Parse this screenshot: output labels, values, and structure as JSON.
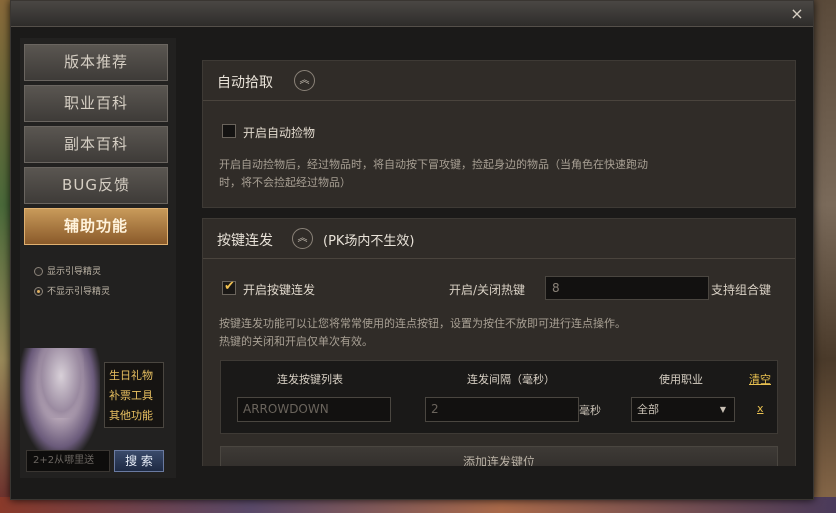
{
  "window": {
    "close_label": "×"
  },
  "sidebar": {
    "items": [
      {
        "label": "版本推荐"
      },
      {
        "label": "职业百科"
      },
      {
        "label": "副本百科"
      },
      {
        "label": "BUG反馈"
      },
      {
        "label": "辅助功能"
      }
    ],
    "radios": [
      {
        "label": "显示引导精灵",
        "checked": false
      },
      {
        "label": "不显示引导精灵",
        "checked": true
      }
    ],
    "links": [
      "生日礼物",
      "补票工具",
      "其他功能"
    ],
    "search": {
      "placeholder": "2+2从哪里送",
      "button": "搜 索"
    }
  },
  "auto_pickup": {
    "title": "自动拾取",
    "collapse_icon": "︽",
    "checkbox_label": "开启自动捡物",
    "checked": false,
    "description_line1": "开启自动捡物后，经过物品时，将自动按下冒攻键，捡起身边的物品（当角色在快速跑动",
    "description_line2": "时，将不会捡起经过物品）"
  },
  "key_repeat": {
    "title": "按键连发",
    "collapse_icon": "︽",
    "subtitle": "(PK场内不生效)",
    "checkbox_label": "开启按键连发",
    "checked": true,
    "checkmark": "✔",
    "hotkey_label": "开启/关闭热键",
    "hotkey_value": "8",
    "hotkey_suffix": "支持组合键",
    "description_line1": "按键连发功能可以让您将常常使用的连点按钮，设置为按住不放即可进行连点操作。",
    "description_line2": "热键的关闭和开启仅单次有效。",
    "table": {
      "headers": [
        "连发按键列表",
        "连发间隔（毫秒）",
        "使用职业"
      ],
      "clear_label": "清空",
      "rows": [
        {
          "key": "ARROWDOWN",
          "interval": "2",
          "unit": "毫秒",
          "job": "全部",
          "delete": "x"
        }
      ]
    },
    "add_button": "添加连发键位"
  }
}
